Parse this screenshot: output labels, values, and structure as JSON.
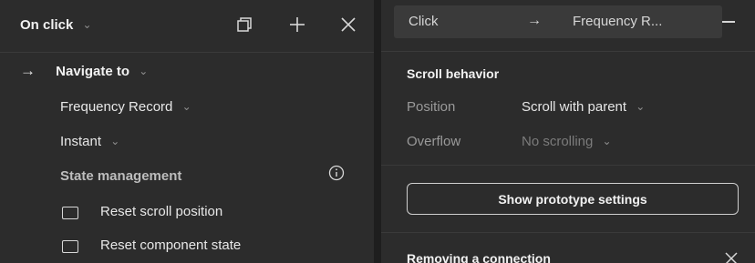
{
  "left_panel": {
    "trigger": {
      "label": "On click",
      "caret": "⌄"
    },
    "header_icons": [
      "duplicate-icon",
      "plus-icon",
      "close-icon"
    ],
    "action": {
      "arrow": "→",
      "label": "Navigate to",
      "caret": "⌄"
    },
    "destination": {
      "label": "Frequency Record",
      "caret": "⌄"
    },
    "animation": {
      "label": "Instant",
      "caret": "⌄"
    },
    "state_management": {
      "title": "State management",
      "info_icon": "info-icon",
      "options": [
        {
          "label": "Reset scroll position",
          "checked": false
        },
        {
          "label": "Reset component state",
          "checked": false
        }
      ]
    }
  },
  "right_panel": {
    "connection": {
      "trigger": "Click",
      "arrow": "→",
      "destination": "Frequency R...",
      "remove_icon": "minus-icon"
    },
    "scroll_behavior": {
      "title": "Scroll behavior",
      "position": {
        "label": "Position",
        "value": "Scroll with parent",
        "caret": "⌄"
      },
      "overflow": {
        "label": "Overflow",
        "value": "No scrolling",
        "caret": "⌄"
      }
    },
    "prototype_button": "Show prototype settings",
    "tip": {
      "title": "Removing a connection",
      "close_icon": "close-icon"
    }
  },
  "colors": {
    "panel_bg": "#2c2c2c",
    "connection_bg": "#3a3a3a",
    "text": "#e6e6e6",
    "muted_text": "#9a9a9a"
  }
}
